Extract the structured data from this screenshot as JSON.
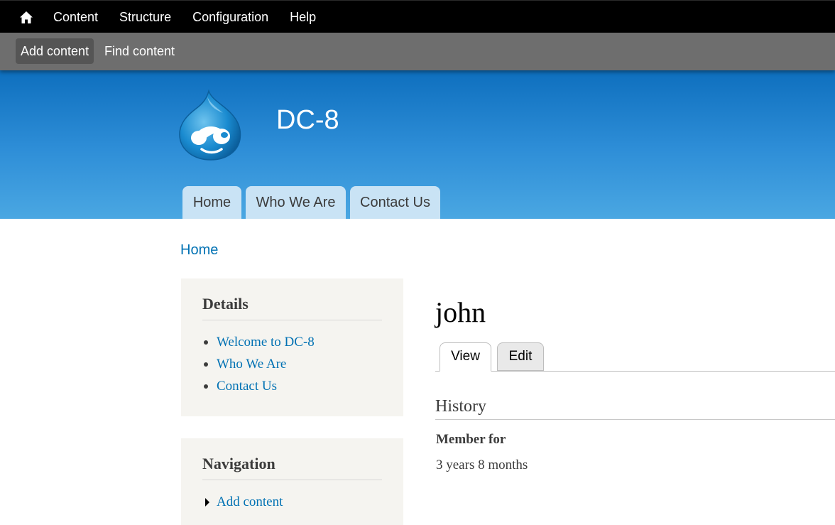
{
  "toolbar": {
    "home_icon": "home-icon",
    "menu": [
      "Content",
      "Structure",
      "Configuration",
      "Help"
    ],
    "tray": [
      "Add content",
      "Find content"
    ]
  },
  "header": {
    "site_name": "DC-8",
    "logo": "drupal-drop-logo",
    "primary_tabs": [
      "Home",
      "Who We Are",
      "Contact Us"
    ]
  },
  "breadcrumb": {
    "home": "Home"
  },
  "sidebar": {
    "details": {
      "title": "Details",
      "links": [
        "Welcome to DC-8",
        "Who We Are",
        "Contact Us"
      ]
    },
    "navigation": {
      "title": "Navigation",
      "links": [
        "Add content"
      ]
    }
  },
  "main": {
    "title": "john",
    "tabs": [
      "View",
      "Edit"
    ],
    "history": {
      "heading": "History",
      "label": "Member for",
      "value": "3 years 8 months"
    }
  },
  "colors": {
    "toolbar_bg": "#000000",
    "tray_bg": "#6e6e6e",
    "header_top": "#0e6fbe",
    "header_bottom": "#4aa7e2",
    "tab_bg": "#c9e3f5",
    "link": "#0071b3",
    "sidebar_bg": "#f5f4f0"
  }
}
